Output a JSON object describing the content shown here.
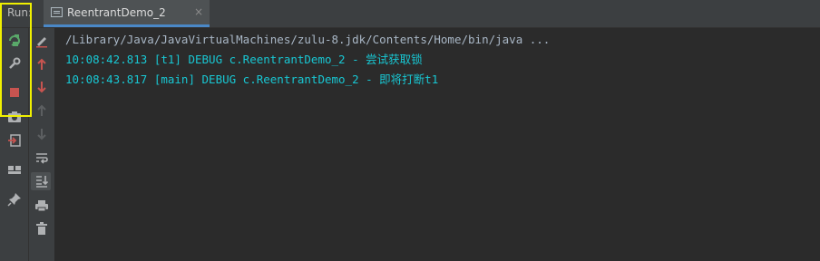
{
  "run_panel": {
    "label": "Run:"
  },
  "tab": {
    "title": "ReentrantDemo_2",
    "close_glyph": "×"
  },
  "console": {
    "lines": [
      "/Library/Java/JavaVirtualMachines/zulu-8.jdk/Contents/Home/bin/java ...",
      "10:08:42.813 [t1] DEBUG c.ReentrantDemo_2 - 尝试获取锁",
      "10:08:43.817 [main] DEBUG c.ReentrantDemo_2 - 即将打断t1"
    ]
  },
  "toolbar_left": [
    "rerun-icon",
    "wrench-icon",
    "stop-icon",
    "camera-icon",
    "login-icon",
    "layout-icon",
    "pin-icon"
  ],
  "toolbar_right": [
    "edit-icon",
    "arrow-up-icon",
    "arrow-down-icon",
    "arrow-up-disabled-icon",
    "arrow-down-disabled-icon",
    "soft-wrap-icon",
    "scroll-to-end-icon",
    "print-icon",
    "trash-icon"
  ],
  "colors": {
    "accent": "#4a88c7",
    "highlight": "#f0f000",
    "console_text": "#18c7d3",
    "stop": "#c75450"
  }
}
